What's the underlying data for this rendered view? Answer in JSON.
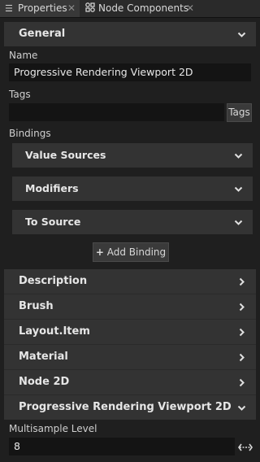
{
  "tabs": [
    {
      "label": "Properties",
      "icon": "list-icon",
      "active": true
    },
    {
      "label": "Node Components",
      "icon": "components-icon",
      "active": false
    }
  ],
  "sections": {
    "general": "General",
    "description": "Description",
    "brush": "Brush",
    "layout_item": "Layout.Item",
    "material": "Material",
    "node_2d": "Node 2D",
    "progressive": "Progressive Rendering Viewport 2D"
  },
  "general": {
    "name_label": "Name",
    "name_value": "Progressive Rendering Viewport 2D",
    "tags_label": "Tags",
    "tags_value": "",
    "tags_button": "Tags",
    "bindings_label": "Bindings",
    "bindings": [
      "Value Sources",
      "Modifiers",
      "To Source"
    ],
    "add_binding": "Add Binding"
  },
  "progressive": {
    "multisample_label": "Multisample Level",
    "multisample_value": "8"
  }
}
